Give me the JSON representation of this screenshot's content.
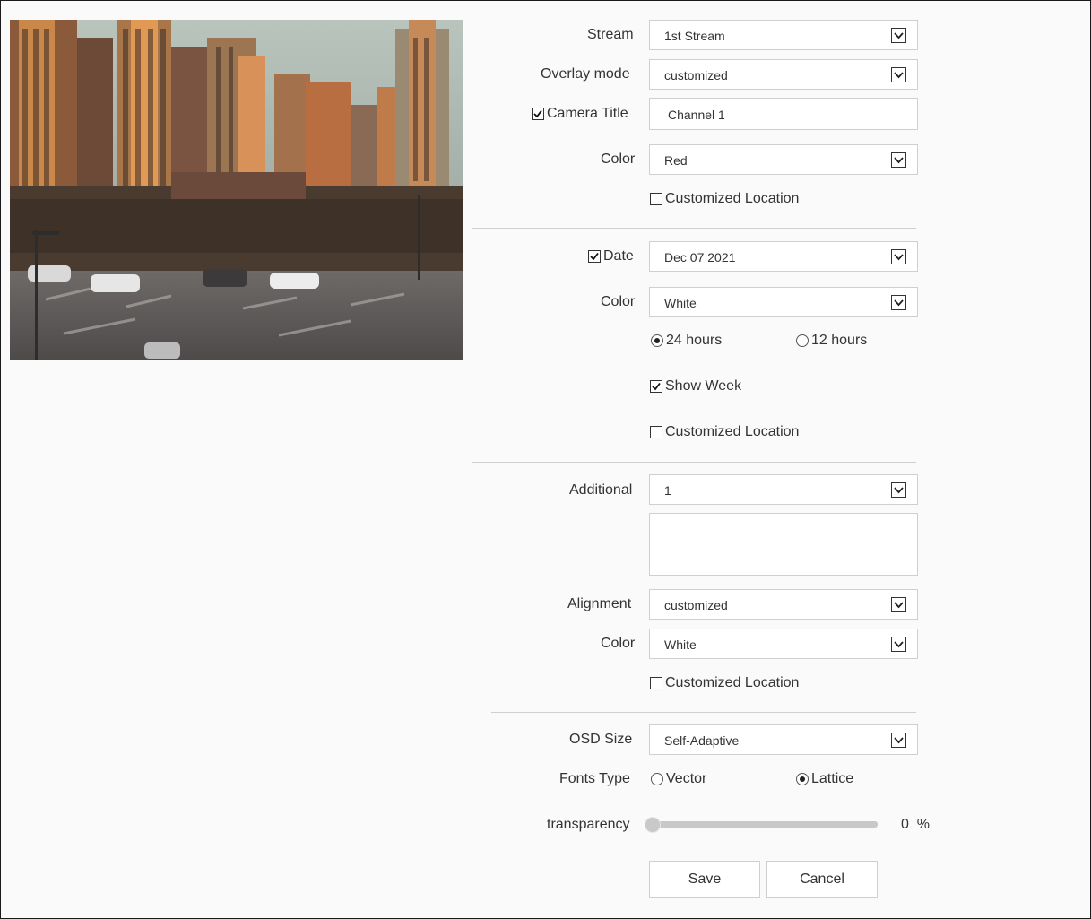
{
  "form": {
    "stream": {
      "label": "Stream",
      "value": "1st Stream"
    },
    "overlay_mode": {
      "label": "Overlay mode",
      "value": "customized"
    },
    "camera_title": {
      "label": "Camera Title",
      "checked": true,
      "value": "Channel 1"
    },
    "title_color": {
      "label": "Color",
      "value": "Red"
    },
    "title_custom_location": {
      "label": "Customized Location",
      "checked": false
    },
    "date": {
      "label": "Date",
      "checked": true,
      "value": "Dec 07 2021"
    },
    "date_color": {
      "label": "Color",
      "value": "White"
    },
    "hours_24": {
      "label": "24 hours",
      "selected": true
    },
    "hours_12": {
      "label": "12 hours",
      "selected": false
    },
    "show_week": {
      "label": "Show Week",
      "checked": true
    },
    "date_custom_location": {
      "label": "Customized Location",
      "checked": false
    },
    "additional": {
      "label": "Additional",
      "value": "1",
      "text": ""
    },
    "alignment": {
      "label": "Alignment",
      "value": "customized"
    },
    "additional_color": {
      "label": "Color",
      "value": "White"
    },
    "additional_custom_location": {
      "label": "Customized Location",
      "checked": false
    },
    "osd_size": {
      "label": "OSD Size",
      "value": "Self-Adaptive"
    },
    "fonts_type": {
      "label": "Fonts Type",
      "vector": "Vector",
      "lattice": "Lattice",
      "selected": "Lattice"
    },
    "transparency": {
      "label": "transparency",
      "value": "0",
      "unit": "%",
      "level": 0
    },
    "save_label": "Save",
    "cancel_label": "Cancel"
  },
  "icons": {
    "dropdown": "chevron-down-icon",
    "checkbox_checked": "checkmark-icon"
  }
}
